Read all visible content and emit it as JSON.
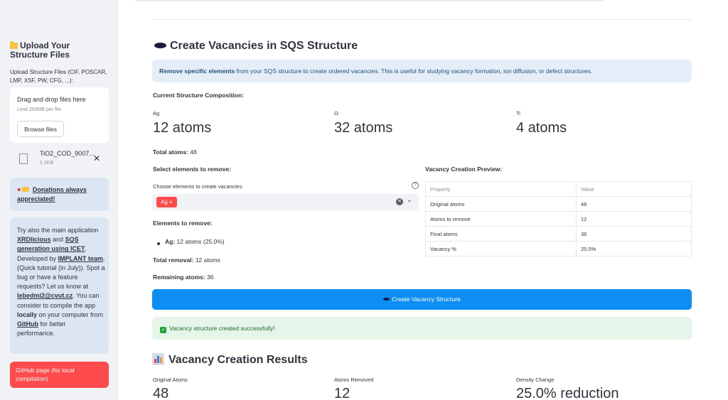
{
  "sidebar": {
    "upload_title": "Upload Your Structure Files",
    "upload_label": "Upload Structure Files (CIF, POSCAR, LMP, XSF, PW, CFG, ...):",
    "dropzone": {
      "title": "Drag and drop files here",
      "limit": "Limit 200MB per file",
      "browse": "Browse files"
    },
    "file": {
      "name": "TiO2_COD_9007...",
      "size": "1.1KB"
    },
    "donate": {
      "text": "Donations always appreciated!"
    },
    "try": {
      "p1": "Try also the main application ",
      "link_xrd": "XRDlicious",
      "p2": " and ",
      "link_sqs": "SQS generation using ICET",
      "p3": ". Developed by ",
      "link_team": "IMPLANT team",
      "p4": ". (Quick tutorial (in July)). Spot a bug or have a feature requests? Let us know at ",
      "link_mail": "lebedmi2@cvut.cz",
      "p5": ". You can consider to compile the app ",
      "bold_locally": "locally",
      "p6": " on your computer from ",
      "link_github": "GitHub",
      "p7": " for better performance."
    },
    "github_button": "GitHub page (for local compilation)"
  },
  "main": {
    "title": "Create Vacancies in SQS Structure",
    "info_bold": "Remove specific elements",
    "info_rest": " from your SQS structure to create ordered vacancies. This is useful for studying vacancy formation, ion diffusion, or defect structures.",
    "composition_title": "Current Structure Composition:",
    "composition": [
      {
        "element": "Ag",
        "value": "12 atoms"
      },
      {
        "element": "O",
        "value": "32 atoms"
      },
      {
        "element": "Ti",
        "value": "4 atoms"
      }
    ],
    "total_label": "Total atoms:",
    "total_value": " 48",
    "select_title": "Select elements to remove:",
    "select_label": "Choose elements to create vacancies:",
    "selected_chip": "Ag",
    "chip_remove": "×",
    "help": "?",
    "elements_to_remove_title": "Elements to remove:",
    "removal_item_bold": "Ag:",
    "removal_item_rest": " 12 atoms (25.0%)",
    "total_removal_label": "Total removal:",
    "total_removal_value": " 12 atoms",
    "remaining_label": "Remaining atoms:",
    "remaining_value": " 36",
    "preview_title": "Vacancy Creation Preview:",
    "preview_table": {
      "headers": [
        "Property",
        "Value"
      ],
      "rows": [
        [
          "Original atoms",
          "48"
        ],
        [
          "Atoms to remove",
          "12"
        ],
        [
          "Final atoms",
          "36"
        ],
        [
          "Vacancy %",
          "25.0%"
        ]
      ]
    },
    "create_button": "Create Vacancy Structure",
    "success": "Vacancy structure created successfully!",
    "results_title": "Vacancy Creation Results",
    "results": [
      {
        "label": "Original Atoms",
        "value": "48"
      },
      {
        "label": "Atoms Removed",
        "value": "12"
      },
      {
        "label": "Density Change",
        "value": "25.0% reduction"
      }
    ]
  },
  "colors": {
    "primary": "#0d8ef5",
    "accent": "#ff4b4b",
    "info_bg": "#e5eef8",
    "success_bg": "#e6f5ea",
    "sidebar_bg": "#f0f2f6"
  }
}
